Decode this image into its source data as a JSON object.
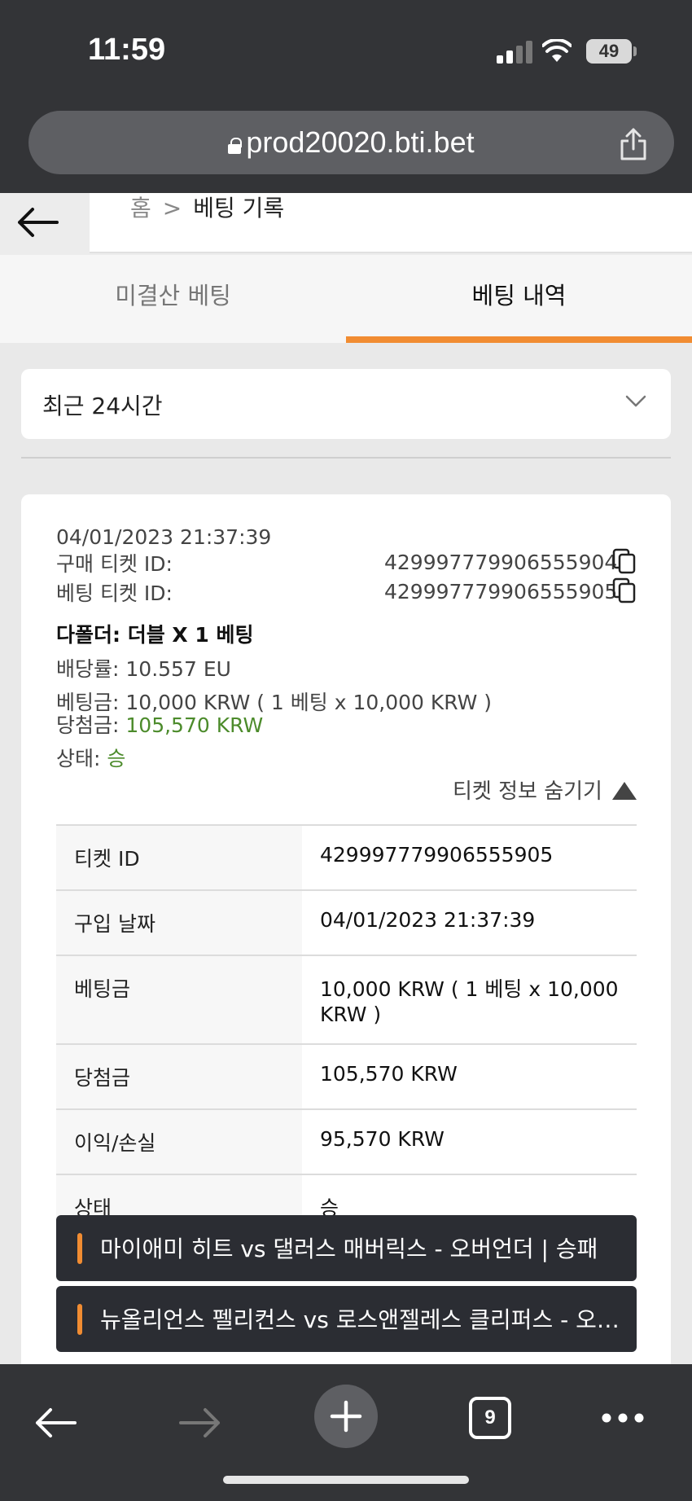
{
  "status_bar": {
    "time": "11:59",
    "battery": "49"
  },
  "browser": {
    "url": "prod20020.bti.bet"
  },
  "breadcrumb": {
    "home": "홈",
    "separator": ">",
    "current": "베팅 기록"
  },
  "tabs": [
    {
      "label": "미결산 베팅",
      "active": false
    },
    {
      "label": "베팅 내역",
      "active": true
    }
  ],
  "filter": {
    "period": "최근 24시간"
  },
  "ticket": {
    "datetime": "04/01/2023 21:37:39",
    "purchase_id_label": "구매 티켓 ID:",
    "purchase_id": "429997779906555904",
    "bet_id_label": "베팅 티켓 ID:",
    "bet_id": "429997779906555905",
    "bet_type": "다폴더: 더블 X 1 베팅",
    "odds_label": "배당률:",
    "odds": "10.557 EU",
    "stake_label": "베팅금:",
    "stake": "10,000 KRW ( 1 베팅 x 10,000 KRW )",
    "winnings_label": "당첨금:",
    "winnings": "105,570 KRW",
    "status_label": "상태:",
    "status": "승",
    "hide_info": "티켓 정보 숨기기",
    "details": [
      {
        "key": "티켓 ID",
        "value": "429997779906555905",
        "highlight": false
      },
      {
        "key": "구입 날짜",
        "value": "04/01/2023 21:37:39",
        "highlight": false
      },
      {
        "key": "베팅금",
        "value": "10,000 KRW ( 1 베팅 x 10,000 KRW )",
        "highlight": false
      },
      {
        "key": "당첨금",
        "value": "105,570 KRW",
        "highlight": true
      },
      {
        "key": "이익/손실",
        "value": "95,570 KRW",
        "highlight": true
      },
      {
        "key": "상태",
        "value": "승",
        "highlight": true
      }
    ],
    "events": [
      "마이애미 히트 vs 댈러스 매버릭스 - 오버언더 | 승패",
      "뉴올리언스 펠리컨스 vs 로스앤젤레스 클리퍼스 - 오버언더 | 승패"
    ]
  },
  "toolbar": {
    "tab_count": "9"
  },
  "colors": {
    "accent": "#f18c32",
    "win": "#4c8b2b",
    "chrome": "#333437"
  }
}
